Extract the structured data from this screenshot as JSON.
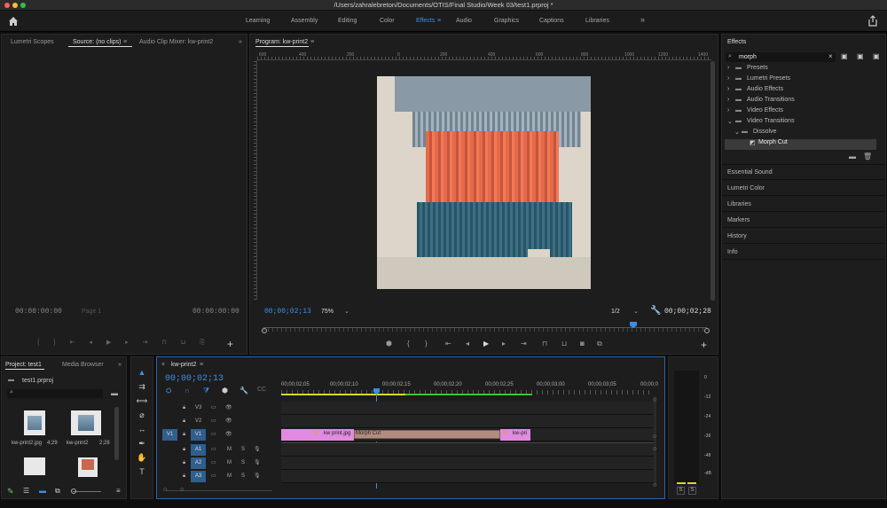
{
  "window": {
    "title": "/Users/zahralebreton/Documents/OTIS/Final Studio/Week 03/test1.prproj *"
  },
  "workspaces": {
    "items": [
      "Learning",
      "Assembly",
      "Editing",
      "Color",
      "Effects",
      "Audio",
      "Graphics",
      "Captions",
      "Libraries"
    ],
    "active": "Effects",
    "more": "»"
  },
  "source_panel": {
    "tabs": [
      "Lumetri Scopes",
      "Source: (no clips)",
      "Audio Clip Mixer: kw-print2"
    ],
    "tc_left": "00:00:00:00",
    "tc_right": "00:00:00:00",
    "page": "Page 1"
  },
  "program": {
    "title": "Program: kw-print2",
    "timecode": "00;00;02;13",
    "zoom": "75%",
    "resolution": "1/2",
    "duration": "00;00;02;28",
    "ruler": [
      "600",
      "400",
      "200",
      "0",
      "200",
      "400",
      "600",
      "800",
      "1000",
      "1200",
      "1400",
      "1600"
    ]
  },
  "effects": {
    "title": "Effects",
    "search": "morph",
    "tree": [
      "Presets",
      "Lumetri Presets",
      "Audio Effects",
      "Audio Transitions",
      "Video Effects",
      "Video Transitions",
      "Dissolve",
      "Morph Cut"
    ],
    "panels": [
      "Essential Sound",
      "Lumetri Color",
      "Libraries",
      "Markers",
      "History",
      "Info"
    ]
  },
  "project": {
    "tabs": [
      "Project: test1",
      "Media Browser"
    ],
    "file": "test1.prproj",
    "items": [
      {
        "name": "kw-print2.jpg",
        "dur": "4;29"
      },
      {
        "name": "kw-print2",
        "dur": "2;28"
      }
    ]
  },
  "timeline": {
    "tab": "kw-print2",
    "timecode": "00;00;02;13",
    "ruler": [
      "00;00;02;05",
      "00;00;02;10",
      "00;00;02;15",
      "00;00;02;20",
      "00;00;02;25",
      "00;00;03;00",
      "00;00;03;05",
      "00;00;0"
    ],
    "video_tracks": [
      {
        "id": "V3",
        "src": ""
      },
      {
        "id": "V2",
        "src": ""
      },
      {
        "id": "V1",
        "src": "V1"
      }
    ],
    "audio_tracks": [
      {
        "id": "A1",
        "src": "A1"
      },
      {
        "id": "A2",
        "src": "A2"
      },
      {
        "id": "A3",
        "src": "A3"
      }
    ],
    "clips": {
      "left": "kw print.jpg",
      "transition": "Morph Cut",
      "right": "kw-pri"
    }
  },
  "meter": {
    "labels": [
      "0",
      "-12",
      "-24",
      "-36",
      "-48",
      "-dB"
    ],
    "solo": [
      "S",
      "S"
    ]
  },
  "colors": {
    "accent": "#3b8fe6",
    "clip": "#e08ae0",
    "transition": "#b38c80"
  }
}
